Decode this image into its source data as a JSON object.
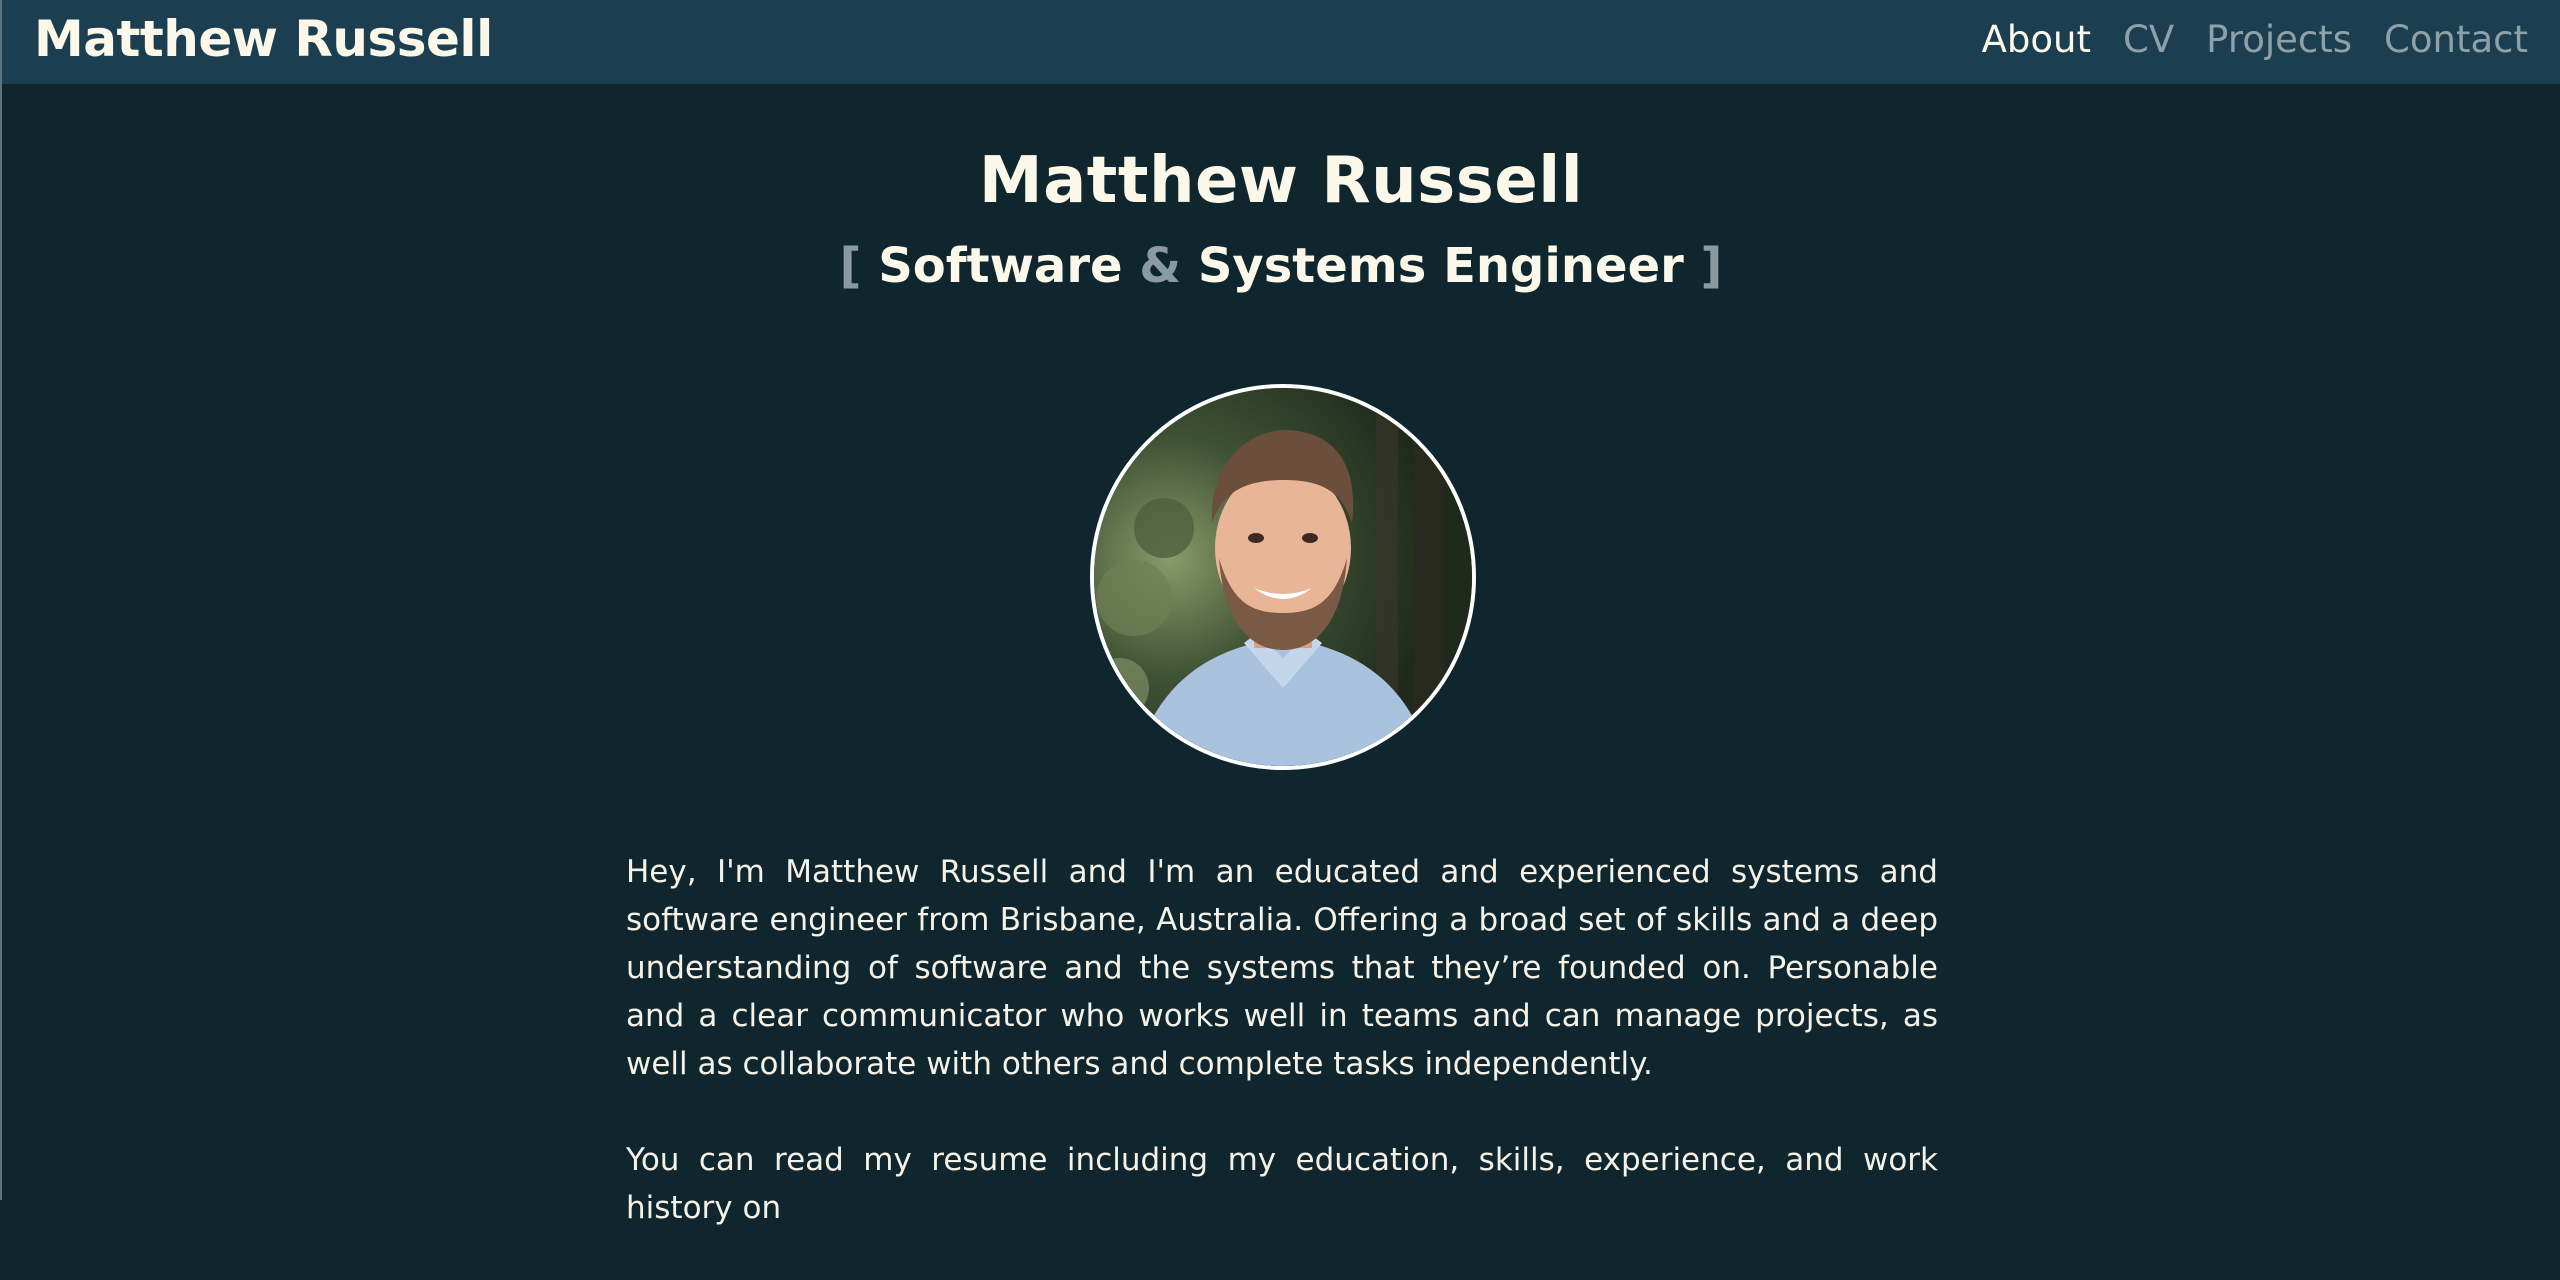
{
  "navbar": {
    "brand": "Matthew Russell",
    "links": [
      {
        "label": "About",
        "active": true
      },
      {
        "label": "CV",
        "active": false
      },
      {
        "label": "Projects",
        "active": false
      },
      {
        "label": "Contact",
        "active": false
      }
    ]
  },
  "hero": {
    "title": "Matthew Russell",
    "subtitle": {
      "open_bracket": "[",
      "part1": "Software",
      "ampersand": "&",
      "part2": "Systems Engineer",
      "close_bracket": "]"
    }
  },
  "avatar": {
    "icon": "profile-photo"
  },
  "bio": {
    "paragraphs": [
      "Hey, I'm Matthew Russell and I'm an educated and experienced systems and software engineer from Brisbane, Australia. Offering a broad set of skills and a deep understanding of software and the systems that they’re founded on. Personable and a clear communicator who works well in teams and can manage projects, as well as collaborate with others and complete tasks independently.",
      "You can read my resume including my education, skills, experience, and work history on"
    ]
  },
  "colors": {
    "navbar_bg": "#1b3e50",
    "page_bg": "#10262f",
    "text": "#fbf8ea",
    "muted": "#8ea0a8"
  }
}
